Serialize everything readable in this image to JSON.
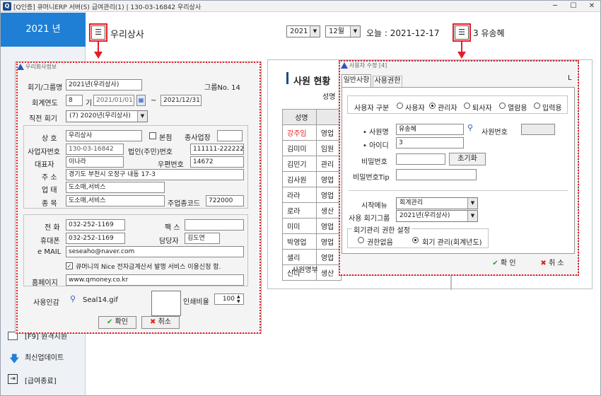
{
  "window": {
    "logo": "Q",
    "title": "[Q인증] 큐머니ERP 서버(S)   급여관리(1)  | 130-03-16842  우리상사",
    "min": "─",
    "max": "☐",
    "close": "✕"
  },
  "sidebar": {
    "year": "2021 년",
    "items": [
      {
        "label": "[F9] 원격지원"
      },
      {
        "label": "최신업데이트"
      },
      {
        "label": "[급여종료]"
      }
    ]
  },
  "header": {
    "company": "우리상사",
    "year": "2021",
    "month": "12월",
    "today": "오늘 : 2021-12-17",
    "user": "3 유송혜"
  },
  "company_dialog": {
    "title": "우리회사정보",
    "fields": {
      "fiscal_name_label": "회기/그룹명",
      "fiscal_name": "2021년(우리상사)",
      "group_no": "그룹No. 14",
      "fiscal_year_label": "회계연도",
      "fiscal_num": "8",
      "period_label": "기",
      "start_date": "2021/01/01",
      "tilde": "~",
      "end_date": "2021/12/31",
      "prev_label": "직전 회기",
      "prev_value": "(7) 2020년(우리상사)",
      "trade_label": "상 호",
      "trade_name": "우리상사",
      "hq_label": "본점",
      "branch_label": "종사업장",
      "bizno_label": "사업자번호",
      "bizno": "130-03-16842",
      "corp_label": "법인(주민)번호",
      "corpno": "111111-2222222",
      "ceo_label": "대표자",
      "ceo": "이나라",
      "zip_label": "우편번호",
      "zip": "14672",
      "addr_label": "주 소",
      "addr": "경기도 부천시 오정구 내동 17-3",
      "type_label": "업 태",
      "type": "도소매,서비스",
      "item_label": "종 목",
      "item": "도소매,서비스",
      "main_code_label": "주업종코드",
      "main_code": "722000",
      "phone_label": "전 화",
      "phone": "032-252-1169",
      "fax_label": "팩 스",
      "mobile_label": "휴대폰",
      "mobile": "032-252-1169",
      "manager_label": "담당자",
      "manager": "김도연",
      "email_label": "e MAIL",
      "email": "seseaho@naver.com",
      "nice_check": "큐머니의 Nice 전자금계산서 발행 서비스 이용신청 함.",
      "homepage_label": "홈페이지",
      "homepage": "www.qmoney.co.kr",
      "stamp_label": "사용인감",
      "stamp_file": "Seal14.gif",
      "print_ratio_label": "인쇄비율",
      "print_ratio": "100"
    },
    "ok": "확인",
    "cancel": "취소"
  },
  "employee_panel": {
    "title": "사원 현황",
    "subtitle": "성명",
    "header": "성명",
    "rows": [
      {
        "name": "강주임",
        "dept": "영업"
      },
      {
        "name": "김미미",
        "dept": "임원"
      },
      {
        "name": "김민기",
        "dept": "관리"
      },
      {
        "name": "김사원",
        "dept": "영업"
      },
      {
        "name": "라라",
        "dept": "영업"
      },
      {
        "name": "로라",
        "dept": "생산"
      },
      {
        "name": "미미",
        "dept": "영업"
      },
      {
        "name": "박영업",
        "dept": "영업"
      },
      {
        "name": "샐리",
        "dept": "영업"
      },
      {
        "name": "신디",
        "dept": "생산"
      }
    ],
    "footer": "사원명부"
  },
  "user_dialog": {
    "title": "사용자 수정 [4]",
    "tabs": [
      "일반사항",
      "사용권한"
    ],
    "type_label": "사용자 구분",
    "types": [
      "사용자",
      "관리자",
      "퇴사자",
      "열람용",
      "입력용"
    ],
    "name_label": "• 사원명",
    "name": "유송혜",
    "empno_label": "사원번호",
    "id_label": "• 아이디",
    "id": "3",
    "pw_label": "비밀번호",
    "reset": "초기화",
    "tip_label": "비밀번호Tip",
    "startmenu_label": "시작메뉴",
    "startmenu": "회계관리",
    "group_label": "사용 회기그룹",
    "group": "2021년(우리상사)",
    "perm_legend": "회기관리 권한 설정",
    "perm_none": "권한없음",
    "perm_manage": "회기 관리(회계년도)",
    "ok": "확 인",
    "cancel": "취 소",
    "side_letter": "L"
  },
  "colors": {
    "accent": "#1e7fd4",
    "highlight": "#e21f26"
  }
}
